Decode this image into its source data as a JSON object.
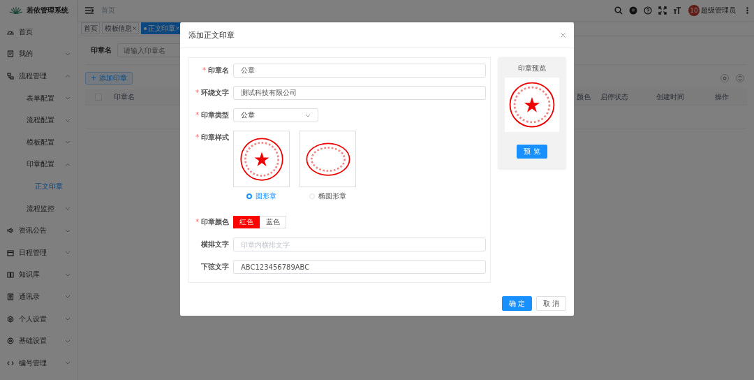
{
  "app": {
    "title": "若依管理系统"
  },
  "sidebar": {
    "items": [
      {
        "label": "首页",
        "selected": false
      },
      {
        "label": "我的",
        "selected": false,
        "expanded": false
      },
      {
        "label": "流程管理",
        "selected": false,
        "expanded": true,
        "children": [
          {
            "label": "表单配置",
            "selected": false,
            "expanded": false
          },
          {
            "label": "流程配置",
            "selected": false,
            "expanded": false
          },
          {
            "label": "模板配置",
            "selected": false,
            "expanded": false
          },
          {
            "label": "印章配置",
            "selected": false,
            "expanded": true,
            "children": [
              {
                "label": "正文印章",
                "selected": true
              }
            ]
          },
          {
            "label": "流程监控",
            "selected": false,
            "expanded": false
          }
        ]
      },
      {
        "label": "资讯公告",
        "selected": false,
        "expanded": false
      },
      {
        "label": "日程管理",
        "selected": false,
        "expanded": false
      },
      {
        "label": "知识库",
        "selected": false,
        "expanded": false
      },
      {
        "label": "通讯录",
        "selected": false,
        "expanded": false
      },
      {
        "label": "个人设置",
        "selected": false,
        "expanded": false
      },
      {
        "label": "基础设置",
        "selected": false,
        "expanded": false
      },
      {
        "label": "编号管理",
        "selected": false,
        "expanded": false
      }
    ]
  },
  "header": {
    "breadcrumb": [
      "首页"
    ],
    "user": {
      "avatar_text": "10",
      "name": "超级管理员"
    }
  },
  "tags": [
    {
      "label": "首页",
      "selected": false,
      "closable": false
    },
    {
      "label": "模板信息",
      "selected": false,
      "closable": true
    },
    {
      "label": "正文印章",
      "selected": true,
      "closable": true
    }
  ],
  "search": {
    "label": "印章名",
    "placeholder": "请输入印章名"
  },
  "add_button": "+ 添加印章",
  "table": {
    "select_all": {
      "checked": false
    },
    "columns": [
      "印章名",
      "颜色",
      "启停状态",
      "创建时间",
      "操作"
    ]
  },
  "dialog": {
    "title": "添加正文印章",
    "fields": [
      {
        "kind": "text",
        "label": "印章名",
        "required_mark": "*",
        "value": "公章"
      },
      {
        "kind": "text",
        "label": "环绕文字",
        "required_mark": "*",
        "value": "测试科技有限公司"
      },
      {
        "kind": "select",
        "label": "印章类型",
        "required_mark": "*",
        "value": "公章"
      },
      {
        "kind": "seal_style",
        "label": "印章样式",
        "required_mark": "*",
        "options": [
          {
            "label": "圆形章",
            "kind": "circle",
            "selected": true
          },
          {
            "label": "椭圆形章",
            "kind": "ellipse",
            "selected": false
          }
        ]
      },
      {
        "kind": "segmented",
        "label": "印章颜色",
        "required_mark": "*",
        "options": [
          {
            "label": "红色",
            "selected": true
          },
          {
            "label": "蓝色",
            "selected": false
          }
        ]
      },
      {
        "kind": "text",
        "label": "横排文字",
        "placeholder": "印章内横排文字"
      },
      {
        "kind": "text",
        "label": "下弦文字",
        "value": "ABC123456789ABC"
      }
    ],
    "preview": {
      "title": "印章预览",
      "button": "预 览"
    },
    "buttons": [
      {
        "label": "确 定",
        "primary": true
      },
      {
        "label": "取 消",
        "primary": false
      }
    ]
  }
}
